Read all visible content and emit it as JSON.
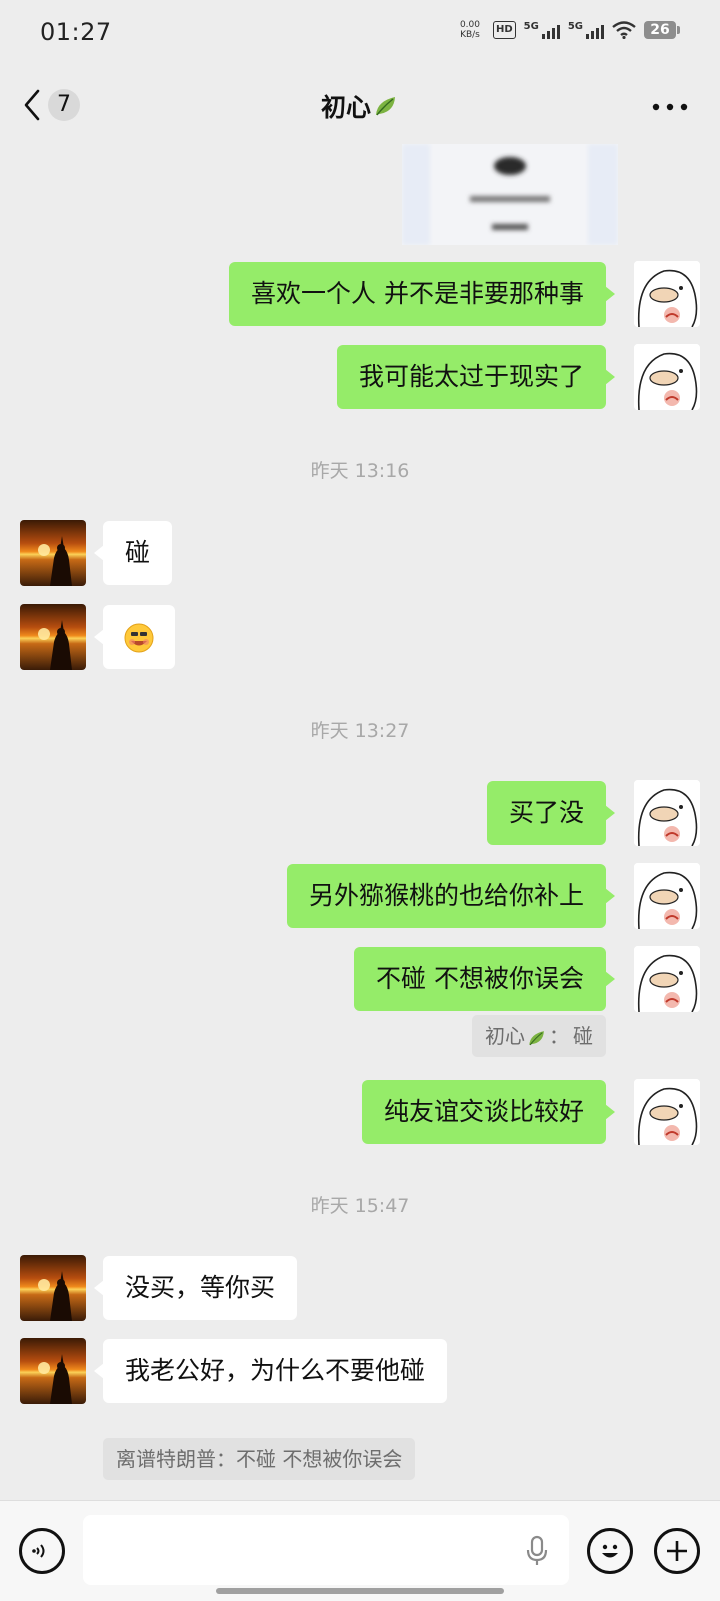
{
  "status_bar": {
    "time": "01:27",
    "net_speed_value": "0.00",
    "net_speed_unit": "KB/s",
    "hd_label": "HD",
    "sim1_label": "5G",
    "sim2_label": "5G",
    "battery": "26"
  },
  "header": {
    "back_badge": "7",
    "title": "初心",
    "more_icon": "more-dots-icon"
  },
  "messages": [
    {
      "side": "me",
      "text": "喜欢一个人 并不是非要那种事"
    },
    {
      "side": "me",
      "text": "我可能太过于现实了"
    },
    {
      "type": "time",
      "text": "昨天 13:16"
    },
    {
      "side": "them",
      "text": "碰"
    },
    {
      "side": "them",
      "emoji": "grinning-emoji"
    },
    {
      "type": "time",
      "text": "昨天 13:27"
    },
    {
      "side": "me",
      "text": "买了没"
    },
    {
      "side": "me",
      "text": "另外猕猴桃的也给你补上"
    },
    {
      "side": "me",
      "text": "不碰 不想被你误会"
    },
    {
      "type": "quote",
      "name": "初心",
      "text": "碰"
    },
    {
      "side": "me",
      "text": "纯友谊交谈比较好"
    },
    {
      "type": "time",
      "text": "昨天 15:47"
    },
    {
      "side": "them",
      "text": "没买，等你买"
    },
    {
      "side": "them",
      "text": "我老公好，为什么不要他碰"
    },
    {
      "type": "quote",
      "text": "离谱特朗普：不碰 不想被你误会"
    }
  ],
  "quote1": {
    "name": "初心",
    "sep": "：",
    "text": "碰"
  },
  "input_bar": {
    "voice_icon": "voice-icon",
    "mic_icon": "mic-icon",
    "emoji_icon": "emoji-icon",
    "add_icon": "add-icon"
  },
  "colors": {
    "my_bubble": "#95ec69",
    "their_bubble": "#ffffff",
    "background": "#ededed"
  }
}
